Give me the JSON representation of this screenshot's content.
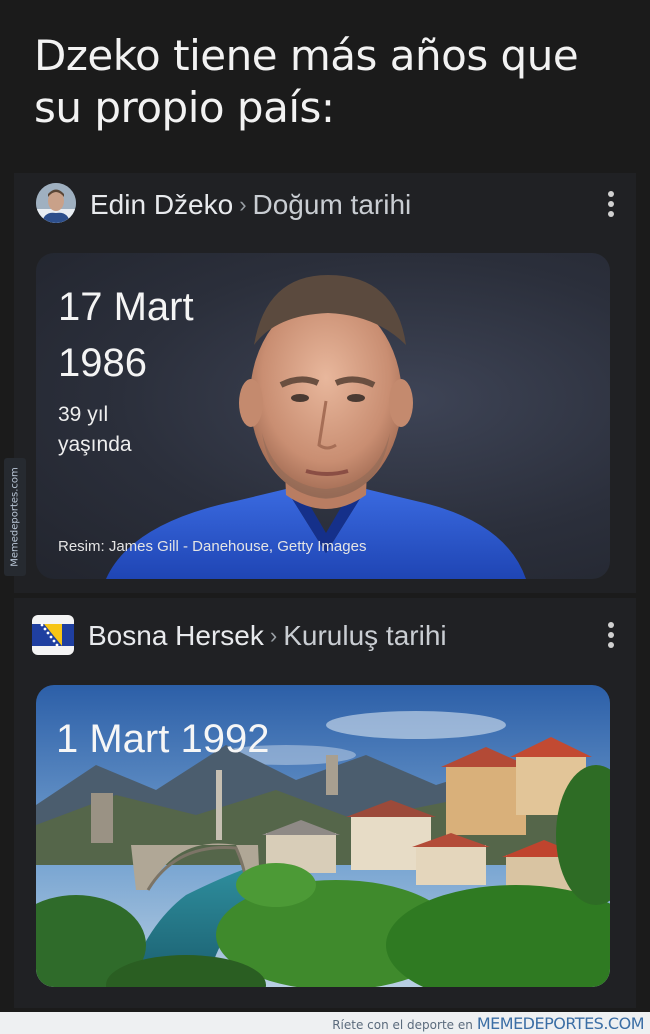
{
  "caption": {
    "line1": "Dzeko tiene más años que",
    "line2": "su propio país:"
  },
  "card_dzeko": {
    "entity": "Edin Džeko",
    "separator": "›",
    "attribute": "Doğum tarihi",
    "date_day_month": "17 Mart",
    "date_year": "1986",
    "age_line1": "39 yıl",
    "age_line2": "yaşında",
    "image_credit": "Resim: James Gill - Danehouse, Getty Images",
    "menu_icon": "more-vert-icon",
    "jersey_color": "#2a55c8"
  },
  "card_bosnia": {
    "entity": "Bosna Hersek",
    "separator": "›",
    "attribute": "Kuruluş tarihi",
    "founded_date": "1 Mart 1992",
    "menu_icon": "more-vert-icon",
    "flag_colors": {
      "blue": "#1f3fa0",
      "yellow": "#f7c515"
    }
  },
  "watermark": {
    "side": "Memedeportes.com",
    "footer_text": "Ríete con el deporte en",
    "footer_brand": "MEMEDEPORTES.COM"
  }
}
